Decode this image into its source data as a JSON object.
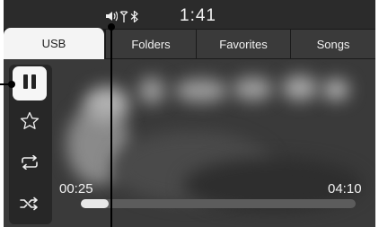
{
  "status": {
    "clock": "1:41",
    "icons": [
      "volume-icon",
      "antenna-icon",
      "bluetooth-icon"
    ]
  },
  "tabs": [
    {
      "label": "USB",
      "active": true
    },
    {
      "label": "Folders",
      "active": false
    },
    {
      "label": "Favorites",
      "active": false
    },
    {
      "label": "Songs",
      "active": false
    }
  ],
  "controls": {
    "pause": "pause-icon",
    "favorite": "star-icon",
    "repeat": "repeat-icon",
    "shuffle": "shuffle-icon"
  },
  "playback": {
    "elapsed": "00:25",
    "total": "04:10",
    "progress_fraction": 0.1
  },
  "colors": {
    "screen_bg": "#262626",
    "active_tab_bg": "#f4f4f4",
    "inactive_tab_bg": "#3a3a3a",
    "text": "#f2f2f2"
  }
}
